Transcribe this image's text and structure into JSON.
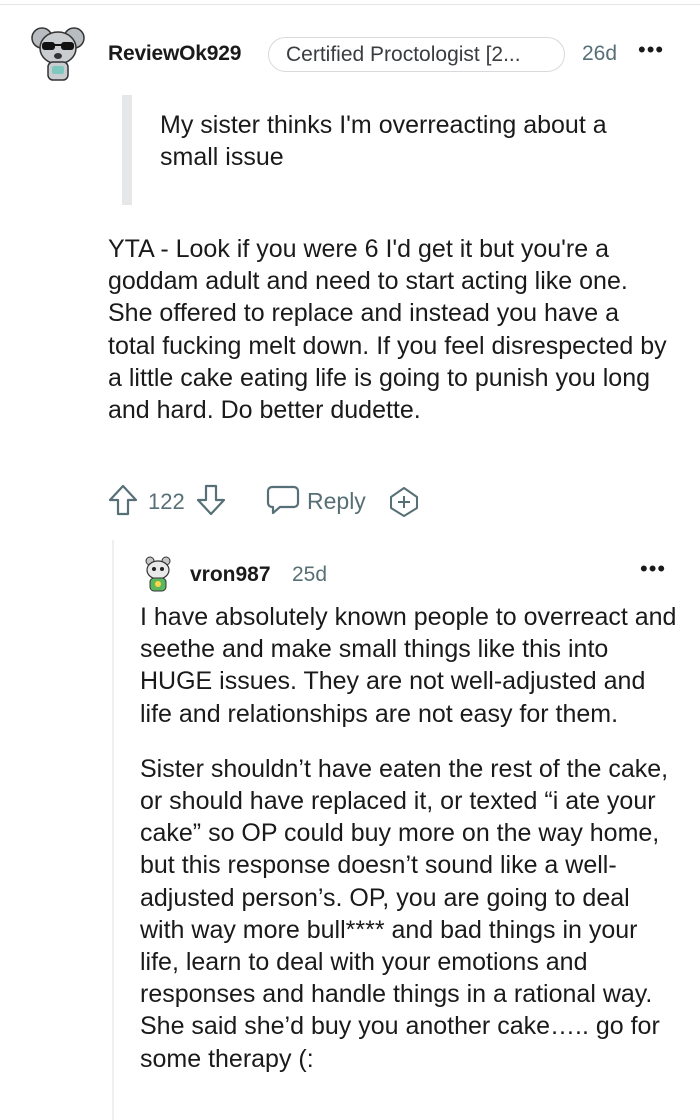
{
  "comment": {
    "avatar": "koala-avatar-with-sunglasses",
    "username": "ReviewOk929",
    "flair": "Certified Proctologist [2...",
    "time": "26d",
    "more": "•••",
    "quote": "My sister thinks I'm overreacting about a small issue",
    "body": "YTA - Look if you were 6 I'd get it but you're a goddam adult and need to start acting like one. She offered to replace and instead you have a total fucking melt down. If you feel disrespected by a little cake eating life is going to punish you long and hard. Do better dudette.",
    "score": "122",
    "reply_label": "Reply",
    "icons": {
      "upvote": "arrow-up-icon",
      "downvote": "arrow-down-icon",
      "reply": "speech-bubble-icon",
      "award": "award-plus-icon"
    }
  },
  "reply": {
    "avatar": "snoo-avatar-green",
    "username": "vron987",
    "time": "25d",
    "more": "•••",
    "paragraphs": [
      "I have absolutely known people to overreact and seethe and make small things like this into HUGE issues. They are not well-adjusted and life and relationships are not easy for them.",
      "Sister shouldn’t have eaten the rest of the cake, or should have replaced it, or texted “i ate your cake” so OP could buy more on the way home, but this response doesn’t sound like a well-adjusted person’s. OP, you are going to deal with way more bull**** and bad things in your life, learn to deal with your emotions and responses and handle things in a rational way. She said she’d buy you another cake….. go for some therapy (:"
    ]
  },
  "colors": {
    "text": "#1a1a1b",
    "meta": "#576f76",
    "quote_bar": "#e5e7e9",
    "flair_border": "#d7dadc"
  }
}
